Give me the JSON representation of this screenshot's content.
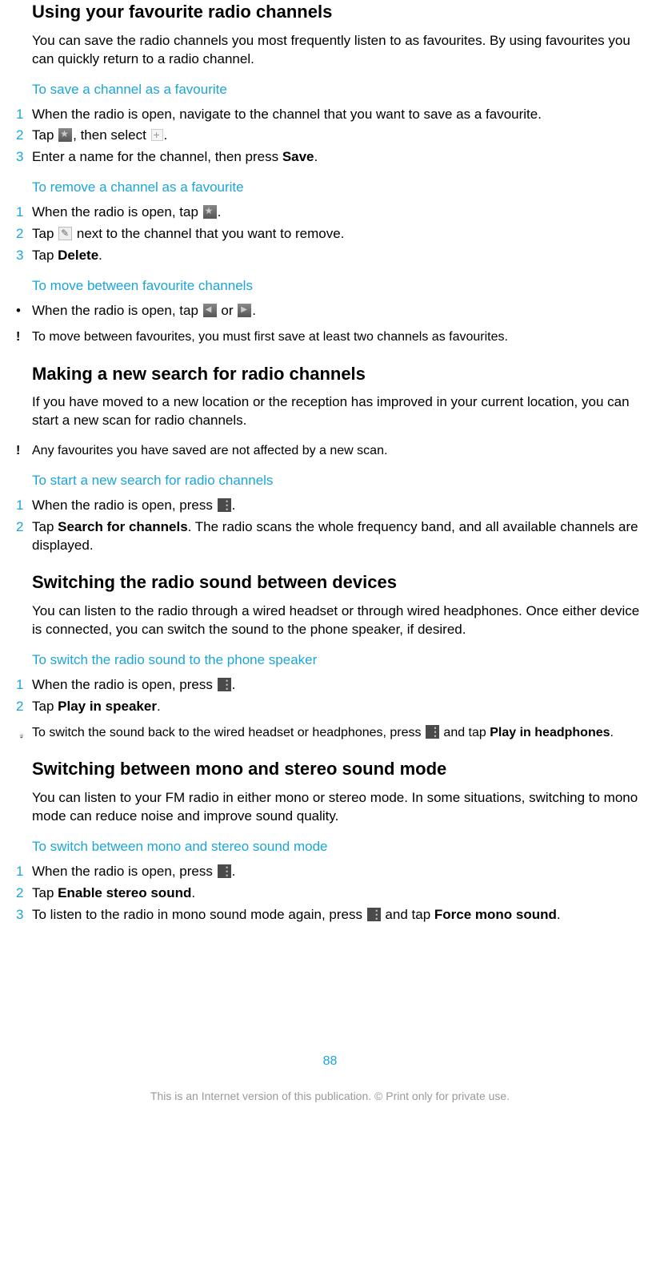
{
  "section1": {
    "title": "Using your favourite radio channels",
    "desc": "You can save the radio channels you most frequently listen to as favourites. By using favourites you can quickly return to a radio channel.",
    "sub1": {
      "heading": "To save a channel as a favourite",
      "s1": "When the radio is open, navigate to the channel that you want to save as a favourite.",
      "s2a": "Tap ",
      "s2b": ", then select ",
      "s2c": ".",
      "s3a": "Enter a name for the channel, then press ",
      "s3b": "Save",
      "s3c": "."
    },
    "sub2": {
      "heading": "To remove a channel as a favourite",
      "s1a": "When the radio is open, tap ",
      "s1b": ".",
      "s2a": "Tap ",
      "s2b": " next to the channel that you want to remove.",
      "s3a": "Tap ",
      "s3b": "Delete",
      "s3c": "."
    },
    "sub3": {
      "heading": "To move between favourite channels",
      "b1a": "When the radio is open, tap ",
      "b1b": " or ",
      "b1c": ".",
      "note": "To move between favourites, you must first save at least two channels as favourites."
    }
  },
  "section2": {
    "title": "Making a new search for radio channels",
    "desc": "If you have moved to a new location or the reception has improved in your current location, you can start a new scan for radio channels.",
    "note": "Any favourites you have saved are not affected by a new scan.",
    "sub1": {
      "heading": "To start a new search for radio channels",
      "s1a": "When the radio is open, press ",
      "s1b": ".",
      "s2a": "Tap ",
      "s2b": "Search for channels",
      "s2c": ". The radio scans the whole frequency band, and all available channels are displayed."
    }
  },
  "section3": {
    "title": "Switching the radio sound between devices",
    "desc": "You can listen to the radio through a wired headset or through wired headphones. Once either device is connected, you can switch the sound to the phone speaker, if desired.",
    "sub1": {
      "heading": "To switch the radio sound to the phone speaker",
      "s1a": "When the radio is open, press ",
      "s1b": ".",
      "s2a": "Tap ",
      "s2b": "Play in speaker",
      "s2c": ".",
      "tipa": "To switch the sound back to the wired headset or headphones, press ",
      "tipb": " and tap ",
      "tipc": "Play in headphones",
      "tipd": "."
    }
  },
  "section4": {
    "title": "Switching between mono and stereo sound mode",
    "desc": "You can listen to your FM radio in either mono or stereo mode. In some situations, switching to mono mode can reduce noise and improve sound quality.",
    "sub1": {
      "heading": "To switch between mono and stereo sound mode",
      "s1a": "When the radio is open, press ",
      "s1b": ".",
      "s2a": "Tap ",
      "s2b": "Enable stereo sound",
      "s2c": ".",
      "s3a": "To listen to the radio in mono sound mode again, press ",
      "s3b": " and tap ",
      "s3c": "Force mono sound",
      "s3d": "."
    }
  },
  "footer": {
    "page": "88",
    "text": "This is an Internet version of this publication. © Print only for private use."
  },
  "nums": {
    "n1": "1",
    "n2": "2",
    "n3": "3",
    "bullet": "•",
    "bang": "!"
  }
}
